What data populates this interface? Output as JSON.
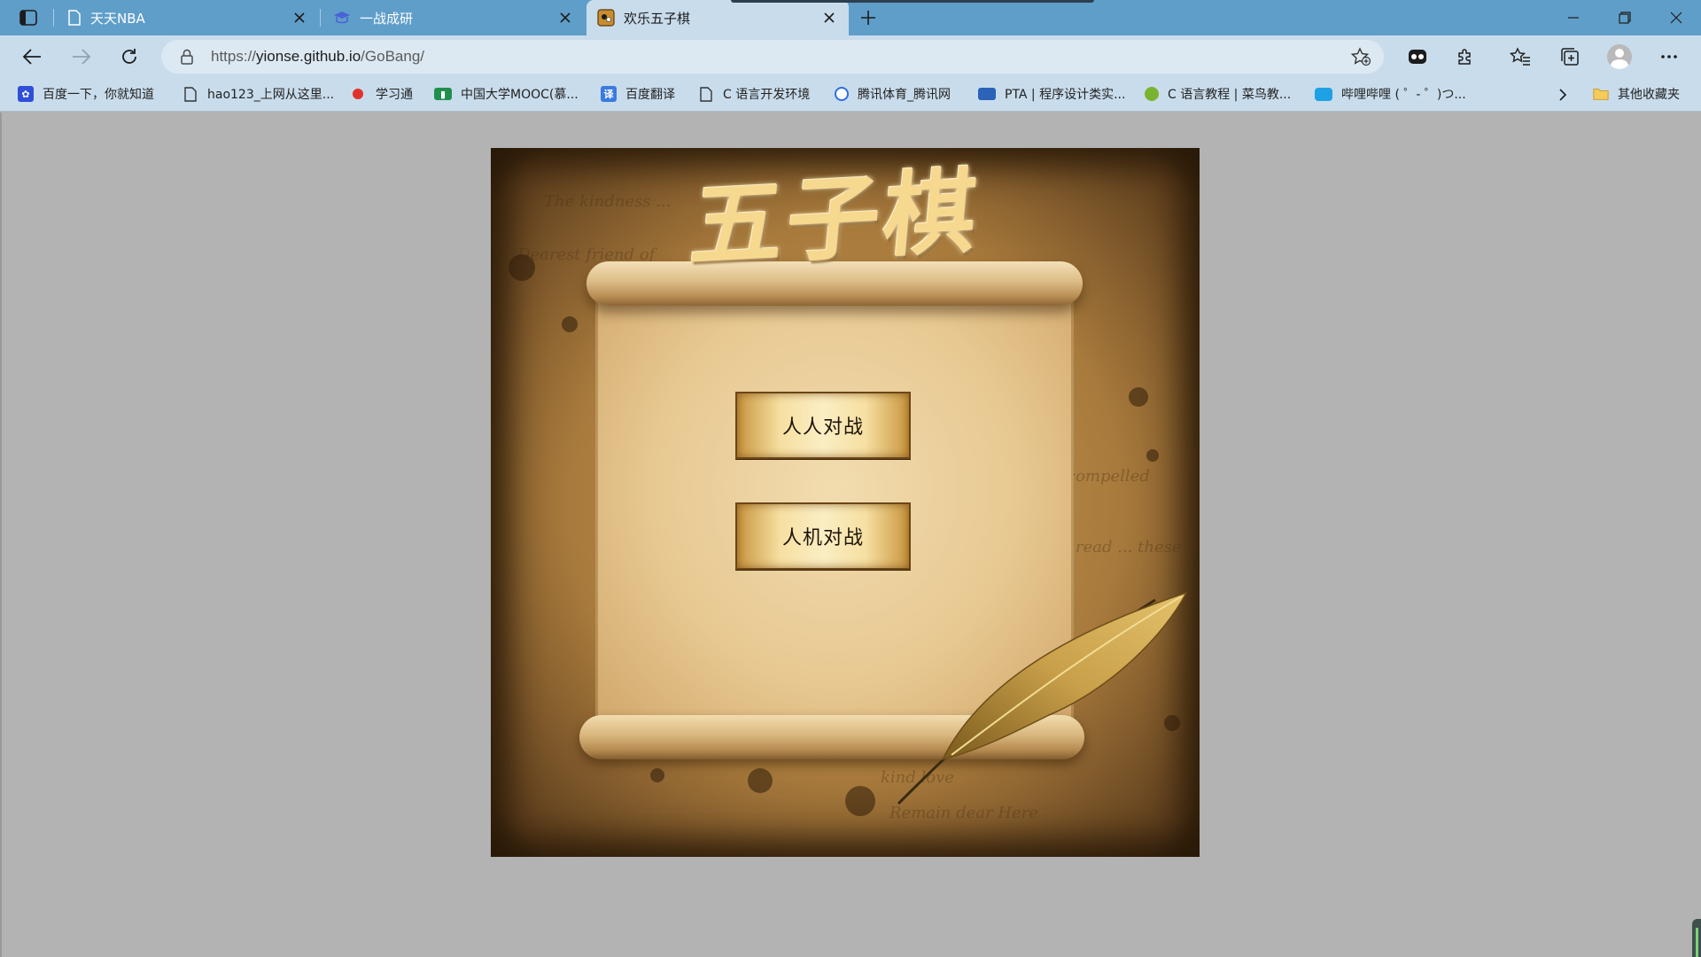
{
  "browser": {
    "tabs": [
      {
        "title": "天天NBA",
        "active": false
      },
      {
        "title": "一战成研",
        "active": false
      },
      {
        "title": "欢乐五子棋",
        "active": true
      }
    ],
    "address": {
      "prefix": "https://",
      "host": "yionse.github.io",
      "path": "/GoBang/"
    },
    "bookmarks": [
      {
        "label": "百度一下，你就知道",
        "icon": "baidu-paw-icon",
        "color": "#2f4fd8"
      },
      {
        "label": "hao123_上网从这里...",
        "icon": "page-icon",
        "color": "#555555"
      },
      {
        "label": "学习通",
        "icon": "xuexitong-icon",
        "color": "#e0322b"
      },
      {
        "label": "中国大学MOOC(慕...",
        "icon": "mooc-icon",
        "color": "#1f8f4e"
      },
      {
        "label": "百度翻译",
        "icon": "translate-icon",
        "color": "#3a7be0"
      },
      {
        "label": "C 语言开发环境",
        "icon": "page-icon",
        "color": "#555555"
      },
      {
        "label": "腾讯体育_腾讯网",
        "icon": "tencent-icon",
        "color": "#2b6fe0"
      },
      {
        "label": "PTA | 程序设计类实...",
        "icon": "pta-icon",
        "color": "#2a63b8"
      },
      {
        "label": "C 语言教程 | 菜鸟教...",
        "icon": "runoob-icon",
        "color": "#79b431"
      },
      {
        "label": "哔哩哔哩 ( ゜- ゜)つ...",
        "icon": "bilibili-icon",
        "color": "#1ea1e3"
      },
      {
        "label": "其他收藏夹",
        "icon": "folder-icon",
        "color": "#e8b63a"
      }
    ]
  },
  "game": {
    "title": "五子棋",
    "buttons": {
      "pvp": "人人对战",
      "pve": "人机对战"
    }
  },
  "colors": {
    "tabstrip": "#5f9ec9",
    "toolbar": "#c9dceb",
    "page_bg": "#b3b3b3"
  }
}
